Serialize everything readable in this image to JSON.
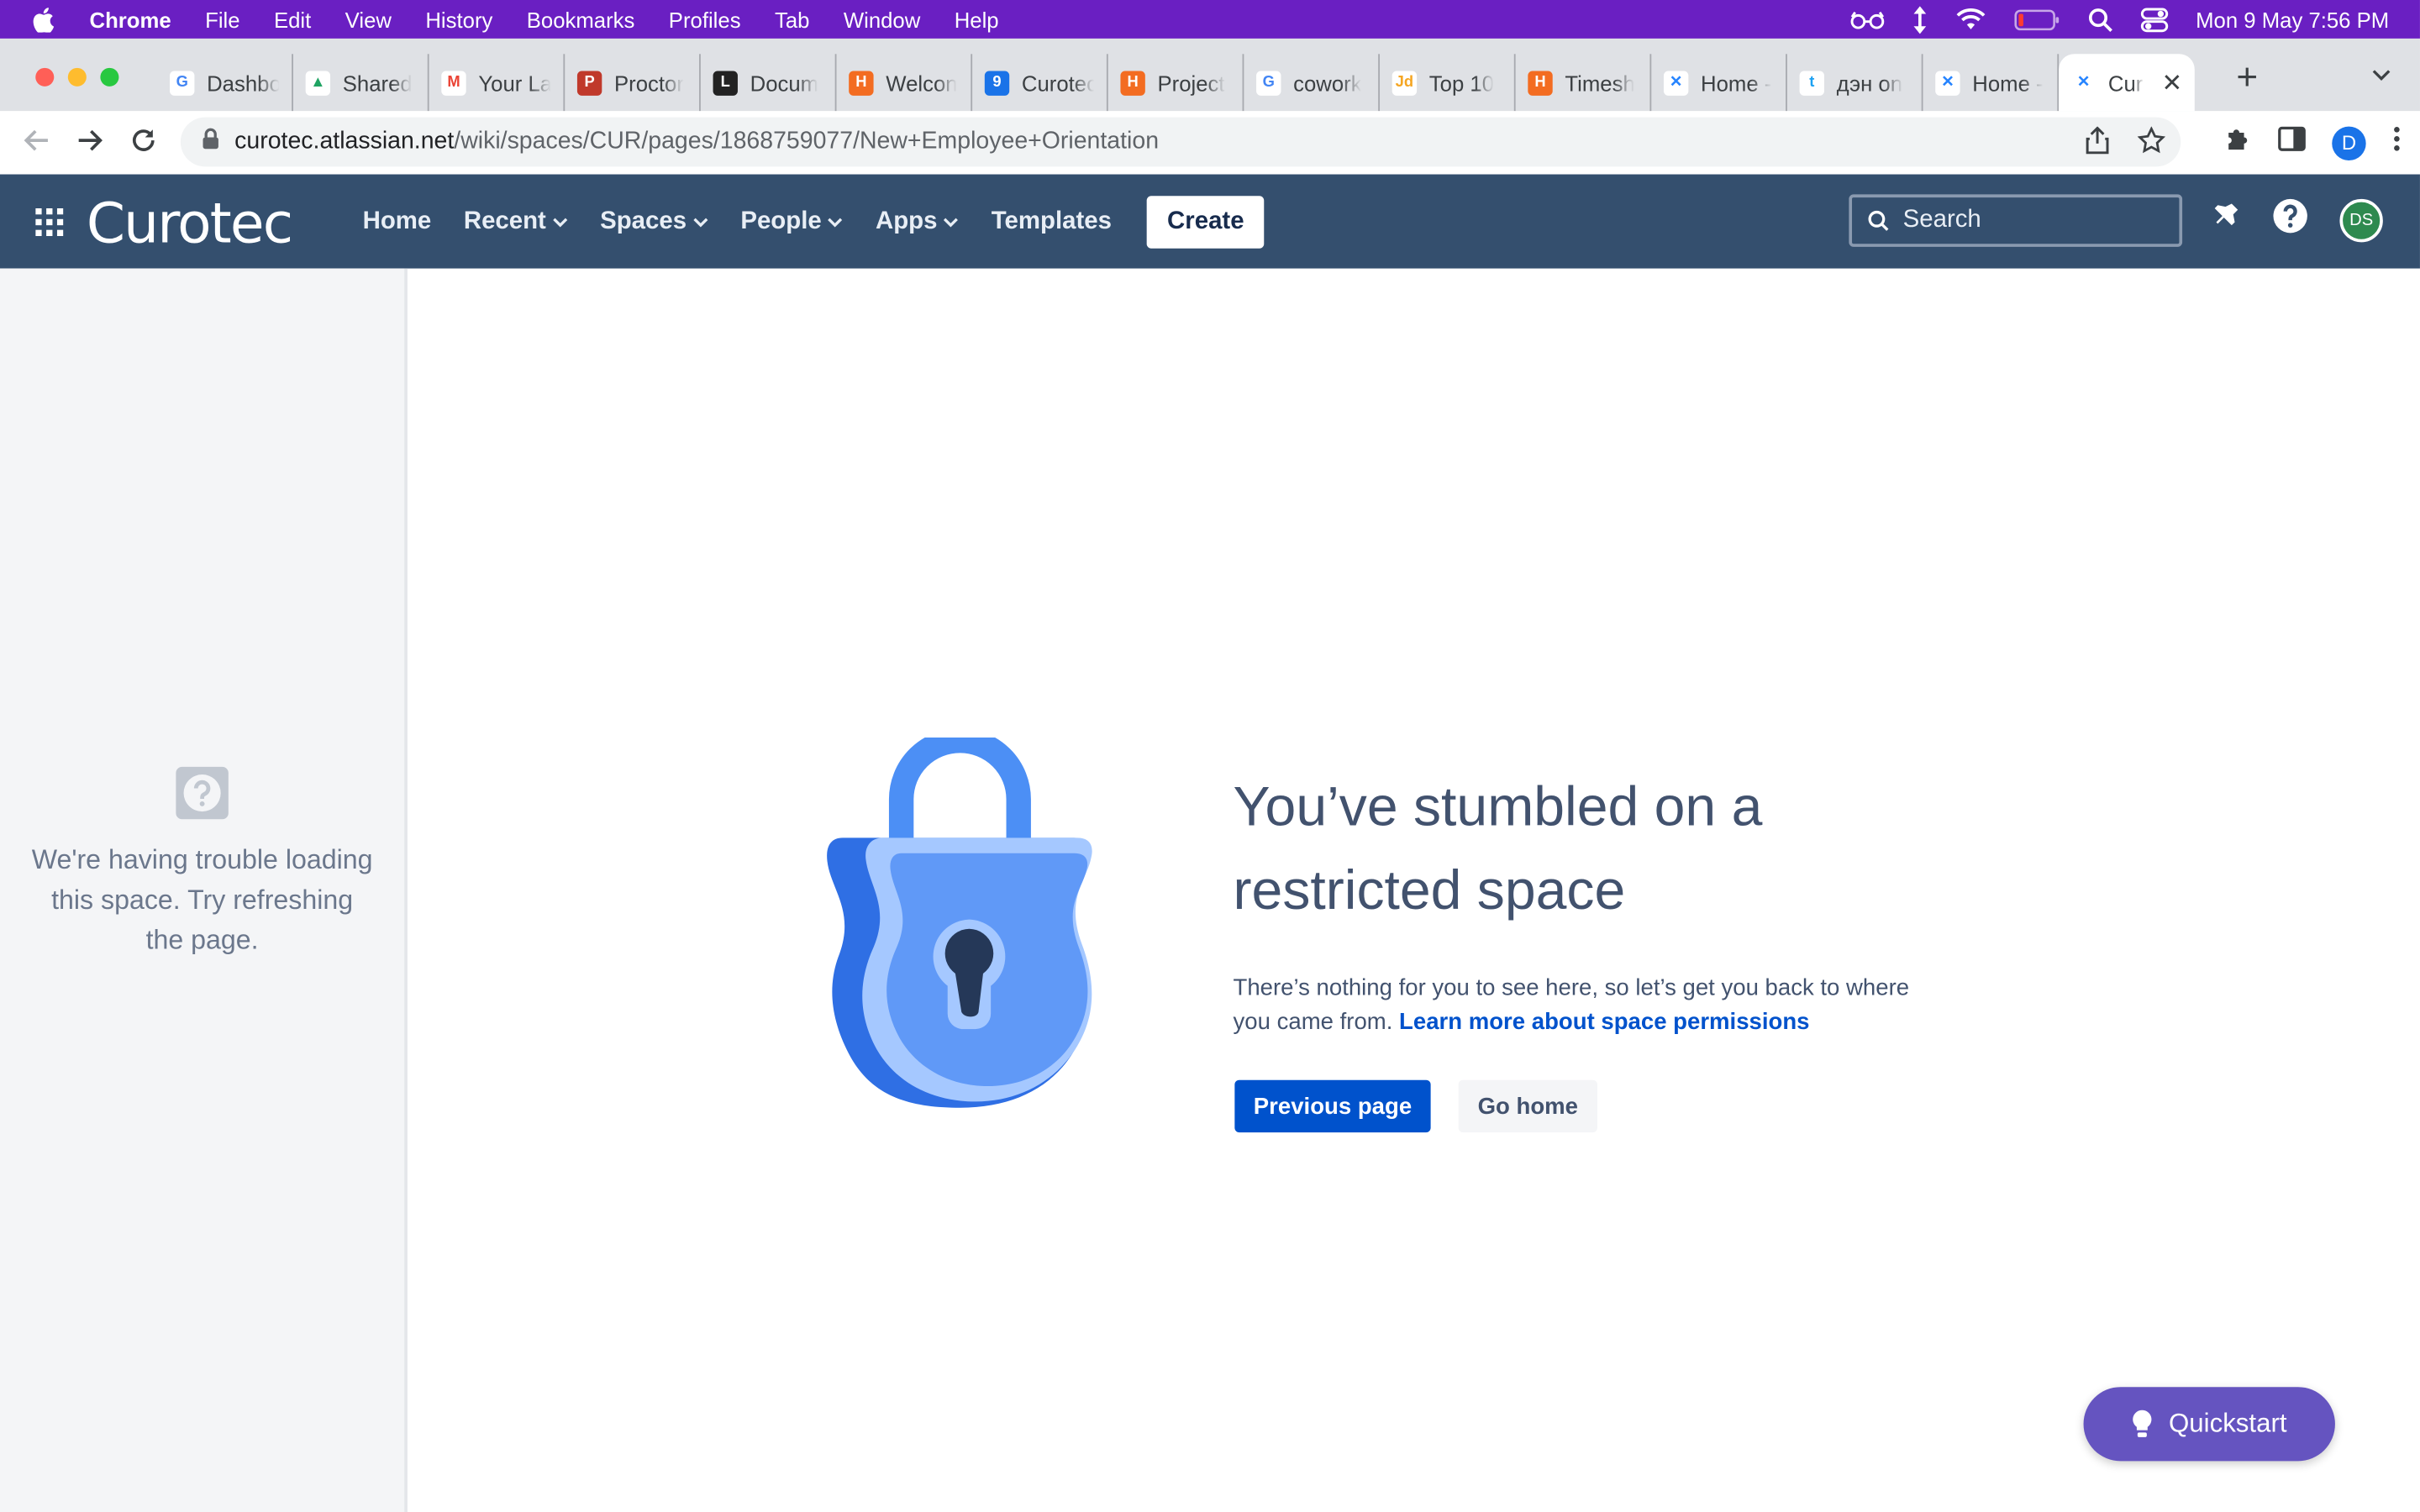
{
  "menubar": {
    "app": "Chrome",
    "items": [
      "File",
      "Edit",
      "View",
      "History",
      "Bookmarks",
      "Profiles",
      "Tab",
      "Window",
      "Help"
    ],
    "clock": "Mon 9 May  7:56 PM"
  },
  "tabs": [
    {
      "label": "Dashbo",
      "icon": "google-icon",
      "color": "#ffffff"
    },
    {
      "label": "Shared",
      "icon": "drive-icon",
      "color": "#ffffff"
    },
    {
      "label": "Your La",
      "icon": "gmail-icon",
      "color": "#ffffff"
    },
    {
      "label": "Proctor",
      "icon": "proctor-icon",
      "color": "#c0392b"
    },
    {
      "label": "Docum",
      "icon": "doc-icon",
      "color": "#222222"
    },
    {
      "label": "Welcon",
      "icon": "harvest-icon",
      "color": "#f36c21"
    },
    {
      "label": "Curotec",
      "icon": "calendar-icon",
      "color": "#1a73e8"
    },
    {
      "label": "Project",
      "icon": "harvest-icon",
      "color": "#f36c21"
    },
    {
      "label": "cowork",
      "icon": "google-icon",
      "color": "#ffffff"
    },
    {
      "label": "Top 10",
      "icon": "jd-icon",
      "color": "#ffffff"
    },
    {
      "label": "Timesh",
      "icon": "harvest-icon",
      "color": "#f36c21"
    },
    {
      "label": "Home -",
      "icon": "confluence-icon",
      "color": "#ffffff"
    },
    {
      "label": "дэн on",
      "icon": "twitter-icon",
      "color": "#ffffff"
    },
    {
      "label": "Home -",
      "icon": "confluence-icon",
      "color": "#ffffff"
    },
    {
      "label": "Cur",
      "icon": "confluence-icon",
      "color": "#ffffff",
      "active": true
    }
  ],
  "address": {
    "host": "curotec.atlassian.net",
    "path": "/wiki/spaces/CUR/pages/1868759077/New+Employee+Orientation"
  },
  "profile_initial": "D",
  "header": {
    "logo": "Curotec",
    "nav": [
      {
        "label": "Home",
        "dropdown": false
      },
      {
        "label": "Recent",
        "dropdown": true
      },
      {
        "label": "Spaces",
        "dropdown": true
      },
      {
        "label": "People",
        "dropdown": true
      },
      {
        "label": "Apps",
        "dropdown": true
      },
      {
        "label": "Templates",
        "dropdown": false
      }
    ],
    "create_label": "Create",
    "search_placeholder": "Search",
    "user_initials": "DS"
  },
  "sidebar": {
    "message": "We're having trouble loading this space. Try refreshing the page."
  },
  "main": {
    "title": "You’ve stumbled on a restricted space",
    "description": "There’s nothing for you to see here, so let’s get you back to where you came from.",
    "link": "Learn more about space permissions",
    "primary_button": "Previous page",
    "secondary_button": "Go home"
  },
  "quickstart": "Quickstart",
  "colors": {
    "menubar": "#6a1fc2",
    "header": "#344f6e",
    "primary": "#0052cc",
    "quickstart": "#6554c0"
  }
}
